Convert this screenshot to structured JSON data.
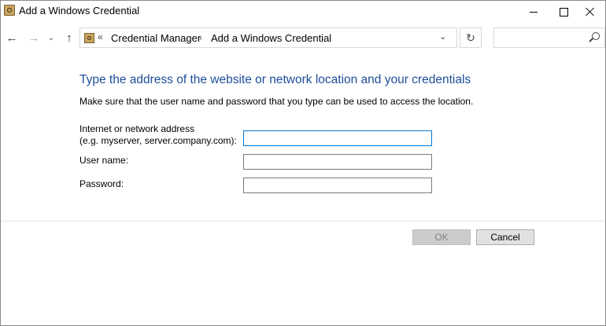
{
  "window": {
    "title": "Add a Windows Credential",
    "icon": "credential-manager-icon"
  },
  "navigation": {
    "back_icon": "←",
    "forward_icon": "→",
    "recent_icon": "⌄",
    "up_icon": "↑",
    "address": {
      "overflow": "«",
      "breadcrumbs": [
        "Credential Manager",
        "Add a Windows Credential"
      ],
      "separator": "›",
      "dropdown_icon": "⌄"
    },
    "refresh_icon": "↻",
    "search": {
      "placeholder": "",
      "value": ""
    }
  },
  "form": {
    "heading": "Type the address of the website or network location and your credentials",
    "description": "Make sure that the user name and password that you type can be used to access the location.",
    "address_label_line1": "Internet or network address",
    "address_label_line2": "(e.g. myserver, server.company.com):",
    "address_value": "",
    "username_label": "User name:",
    "username_value": "",
    "password_label": "Password:",
    "password_value": ""
  },
  "buttons": {
    "ok": "OK",
    "cancel": "Cancel"
  },
  "colors": {
    "heading": "#1e4e9c",
    "focus_border": "#0078d7",
    "ok_disabled_bg": "#cccccc",
    "cancel_bg": "#e1e1e1"
  }
}
